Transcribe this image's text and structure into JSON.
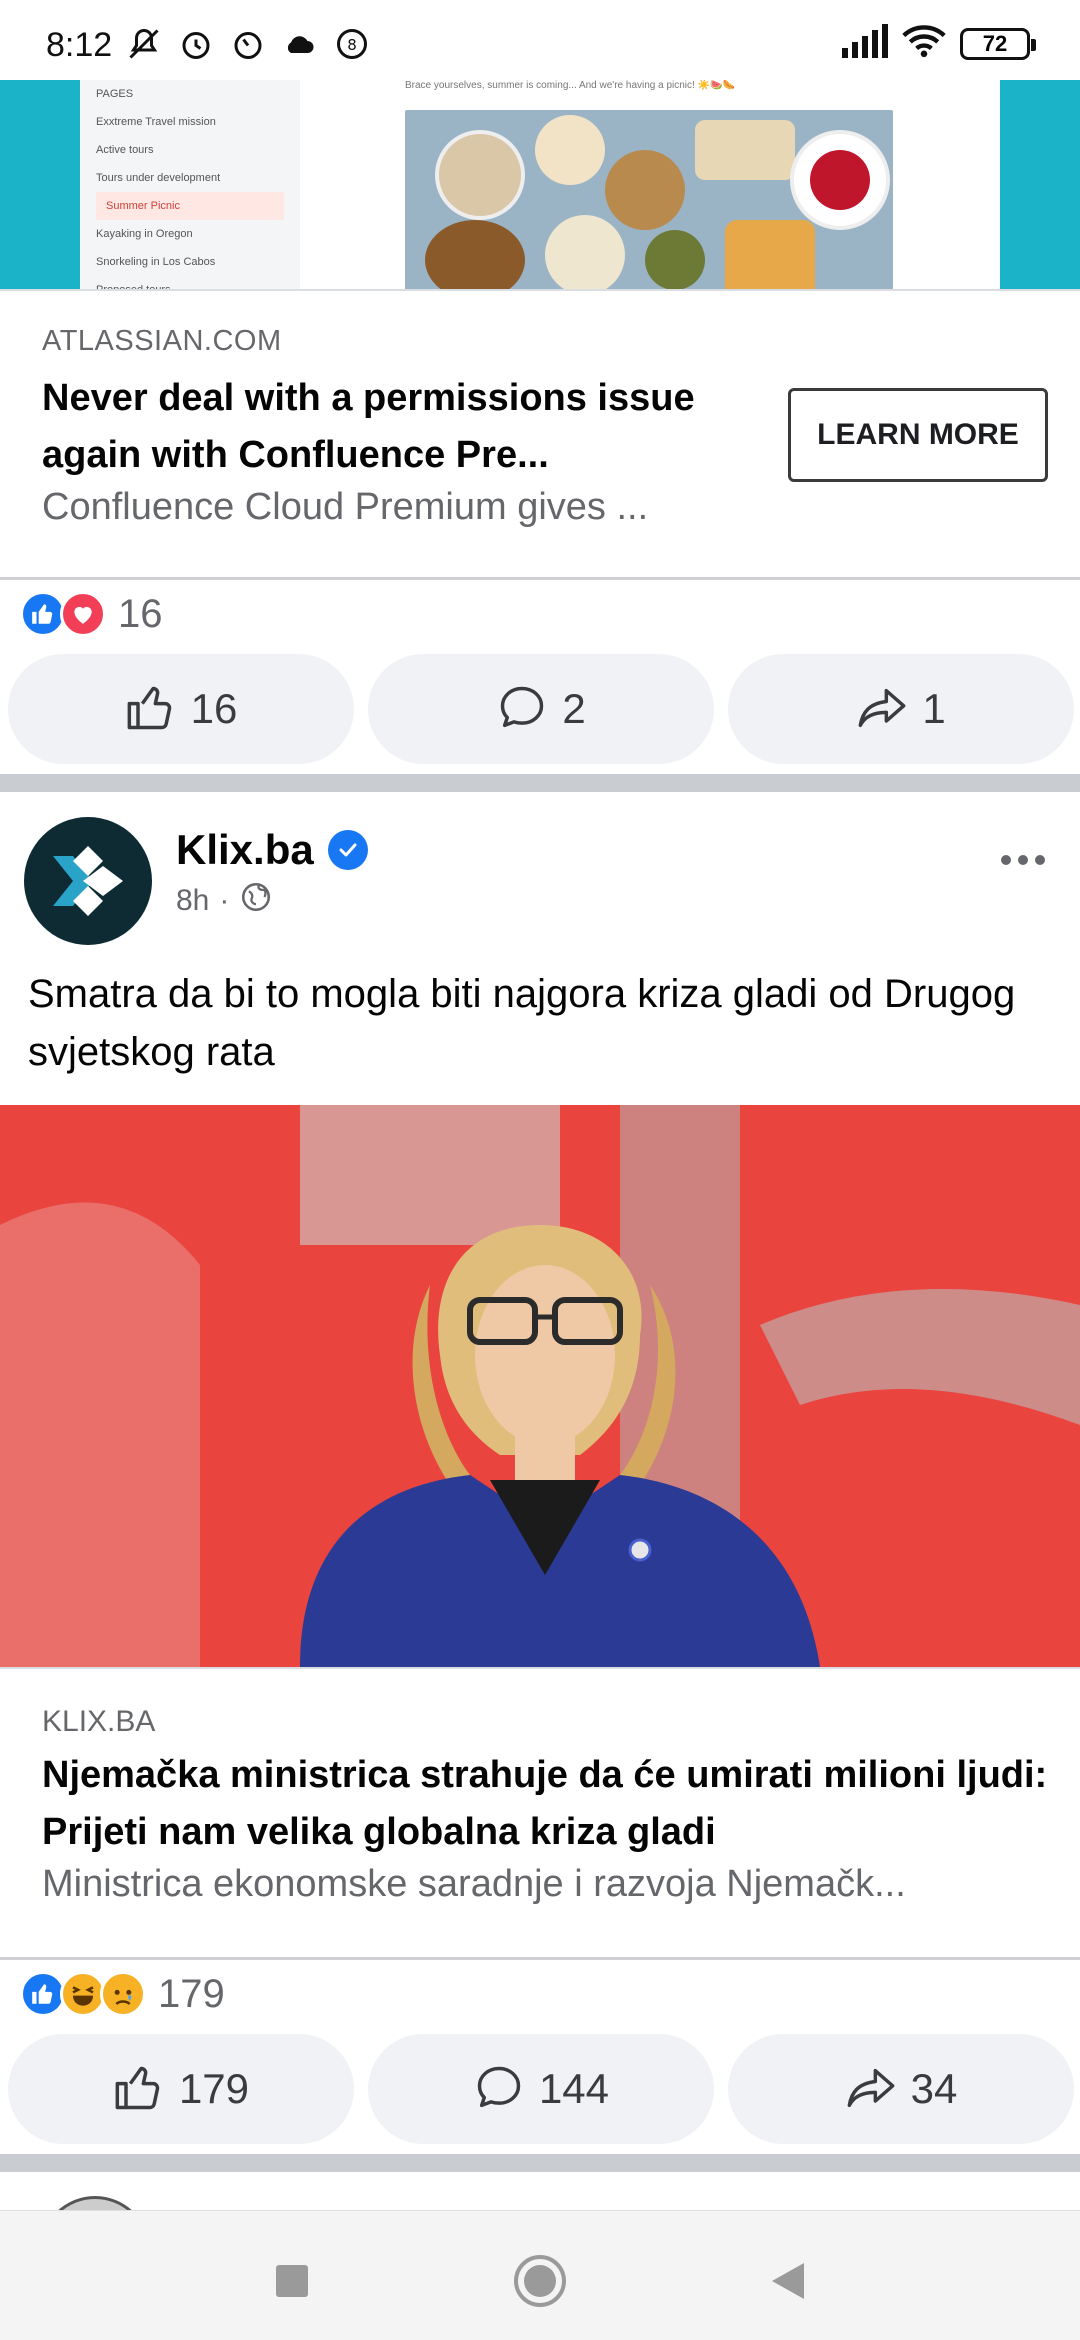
{
  "status_bar": {
    "time": "8:12",
    "battery": "72",
    "icons_left": [
      "mute-icon",
      "alarm-icon",
      "timer-icon",
      "cloud-icon",
      "app-badge-icon"
    ],
    "icons_right": [
      "signal-icon",
      "wifi-icon",
      "battery-icon"
    ]
  },
  "ad": {
    "image_caption": "Brace yourselves, summer is coming... And we're having a picnic! ☀️🍉🌭",
    "image_nav": {
      "header": "PAGES",
      "items": [
        "Exxtreme Travel mission",
        "Active tours",
        "Tours under development",
        "Summer Picnic",
        "Kayaking in Oregon",
        "Snorkeling in Los Cabos",
        "Proposed tours"
      ]
    },
    "domain": "ATLASSIAN.COM",
    "headline": "Never deal with a permissions issue again with Confluence Pre...",
    "description": "Confluence Cloud Premium gives ...",
    "cta": "LEARN MORE",
    "reactions_count": "16",
    "actions": {
      "like": "16",
      "comment": "2",
      "share": "1"
    }
  },
  "post": {
    "author": "Klix.ba",
    "verified": true,
    "time": "8h",
    "audience_icon": "globe-icon",
    "text": "Smatra da bi to mogla biti najgora kriza gladi od Drugog svjetskog rata",
    "link_domain": "KLIX.BA",
    "link_headline": "Njemačka ministrica strahuje da će umirati milioni ljudi: Prijeti nam velika globalna kriza gladi",
    "link_description": "Ministrica ekonomske saradnje i razvoja Njemačk...",
    "reactions_count": "179",
    "actions": {
      "like": "179",
      "comment": "144",
      "share": "34"
    }
  },
  "nav": {
    "buttons": [
      "recents-button",
      "home-button",
      "back-button"
    ]
  },
  "colors": {
    "facebook_blue": "#1877f2",
    "love_red": "#f33e58",
    "separator": "#c9ccd1",
    "button_bg": "#f0f2f5",
    "ad_teal": "#1bb3c7",
    "post_image_red": "#e9443e"
  }
}
